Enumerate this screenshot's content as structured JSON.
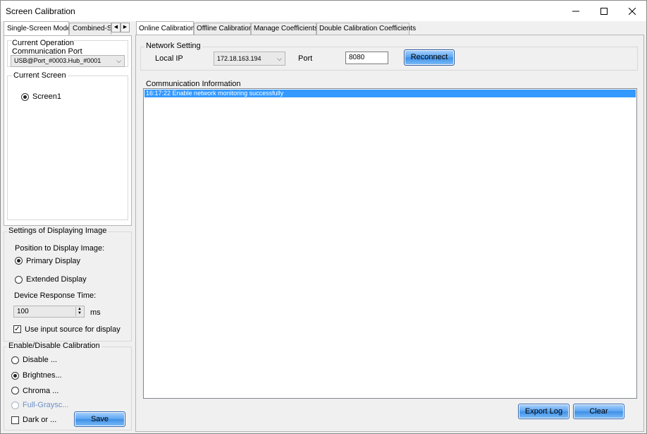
{
  "window": {
    "title": "Screen Calibration"
  },
  "left_tabs": [
    "Single-Screen Mode",
    "Combined-Sc"
  ],
  "comm_group": {
    "title_line1": "Current Operation",
    "title_line2": "Communication Port",
    "port_value": "USB@Port_#0003.Hub_#0001"
  },
  "screen_group": {
    "title": "Current Screen",
    "screen_label": "Screen1"
  },
  "display_group": {
    "title": "Settings of Displaying Image",
    "position_label": "Position to Display Image:",
    "primary_label": "Primary Display",
    "extended_label": "Extended Display",
    "response_label": "Device Response Time:",
    "response_value": "100",
    "response_unit": "ms",
    "use_input_label": "Use input source for display"
  },
  "calib_group": {
    "title": "Enable/Disable Calibration",
    "disable_label": "Disable ...",
    "brightness_label": "Brightnes...",
    "chroma_label": "Chroma ...",
    "full_gray_label": "Full-Graysc...",
    "dark_label": "Dark or ...",
    "save_label": "Save"
  },
  "right_tabs": [
    "Online Calibration",
    "Offline Calibration",
    "Manage Coefficients",
    "Double Calibration Coefficients"
  ],
  "network": {
    "title": "Network Setting",
    "local_ip_label": "Local IP",
    "local_ip_value": "172.18.163.194",
    "port_label": "Port",
    "port_value": "8080",
    "reconnect_label": "Reconnect"
  },
  "comm_info": {
    "title": "Communication Information",
    "entries": [
      "16:17:22  Enable network monitoring successfully"
    ]
  },
  "footer": {
    "export_label": "Export Log",
    "clear_label": "Clear"
  },
  "colors": {
    "selection": "#3399ff",
    "button_accent": "#5aa4ef",
    "disabled_text": "#6e8fc6"
  }
}
